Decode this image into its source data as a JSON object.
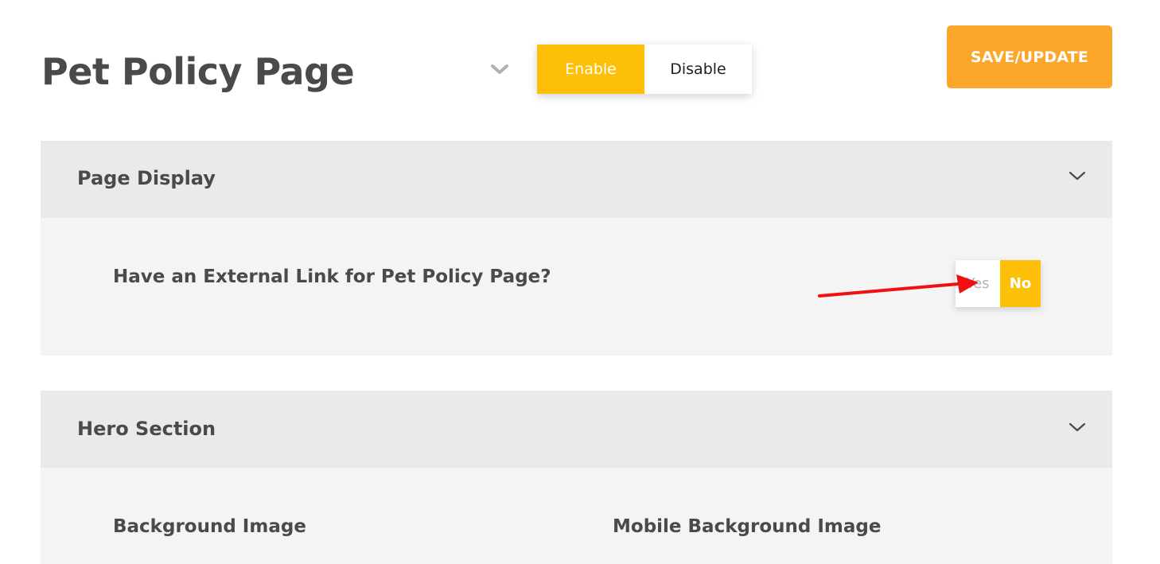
{
  "header": {
    "page_title": "Pet Policy Page",
    "status_toggle": {
      "enable_label": "Enable",
      "disable_label": "Disable",
      "selected": "Enable"
    },
    "save_label": "SAVE/UPDATE"
  },
  "panels": [
    {
      "title": "Page Display",
      "fields": [
        {
          "label": "Have an External Link for Pet Policy Page?",
          "options": [
            "Yes",
            "No"
          ],
          "selected": "No"
        }
      ]
    },
    {
      "title": "Hero Section",
      "fields": [
        {
          "label": "Background Image"
        },
        {
          "label": "Mobile Background Image"
        }
      ]
    }
  ],
  "colors": {
    "accent_yellow": "#fdbf08",
    "save_orange": "#fca62c",
    "panel_header_bg": "#eaeaea",
    "panel_body_bg": "#f4f4f4",
    "text_dark": "#4a4a4a",
    "annotation_red": "#f01010"
  },
  "icons": {
    "title_dropdown": "chevron-down-icon",
    "panel_toggle": "chevron-down-icon"
  }
}
